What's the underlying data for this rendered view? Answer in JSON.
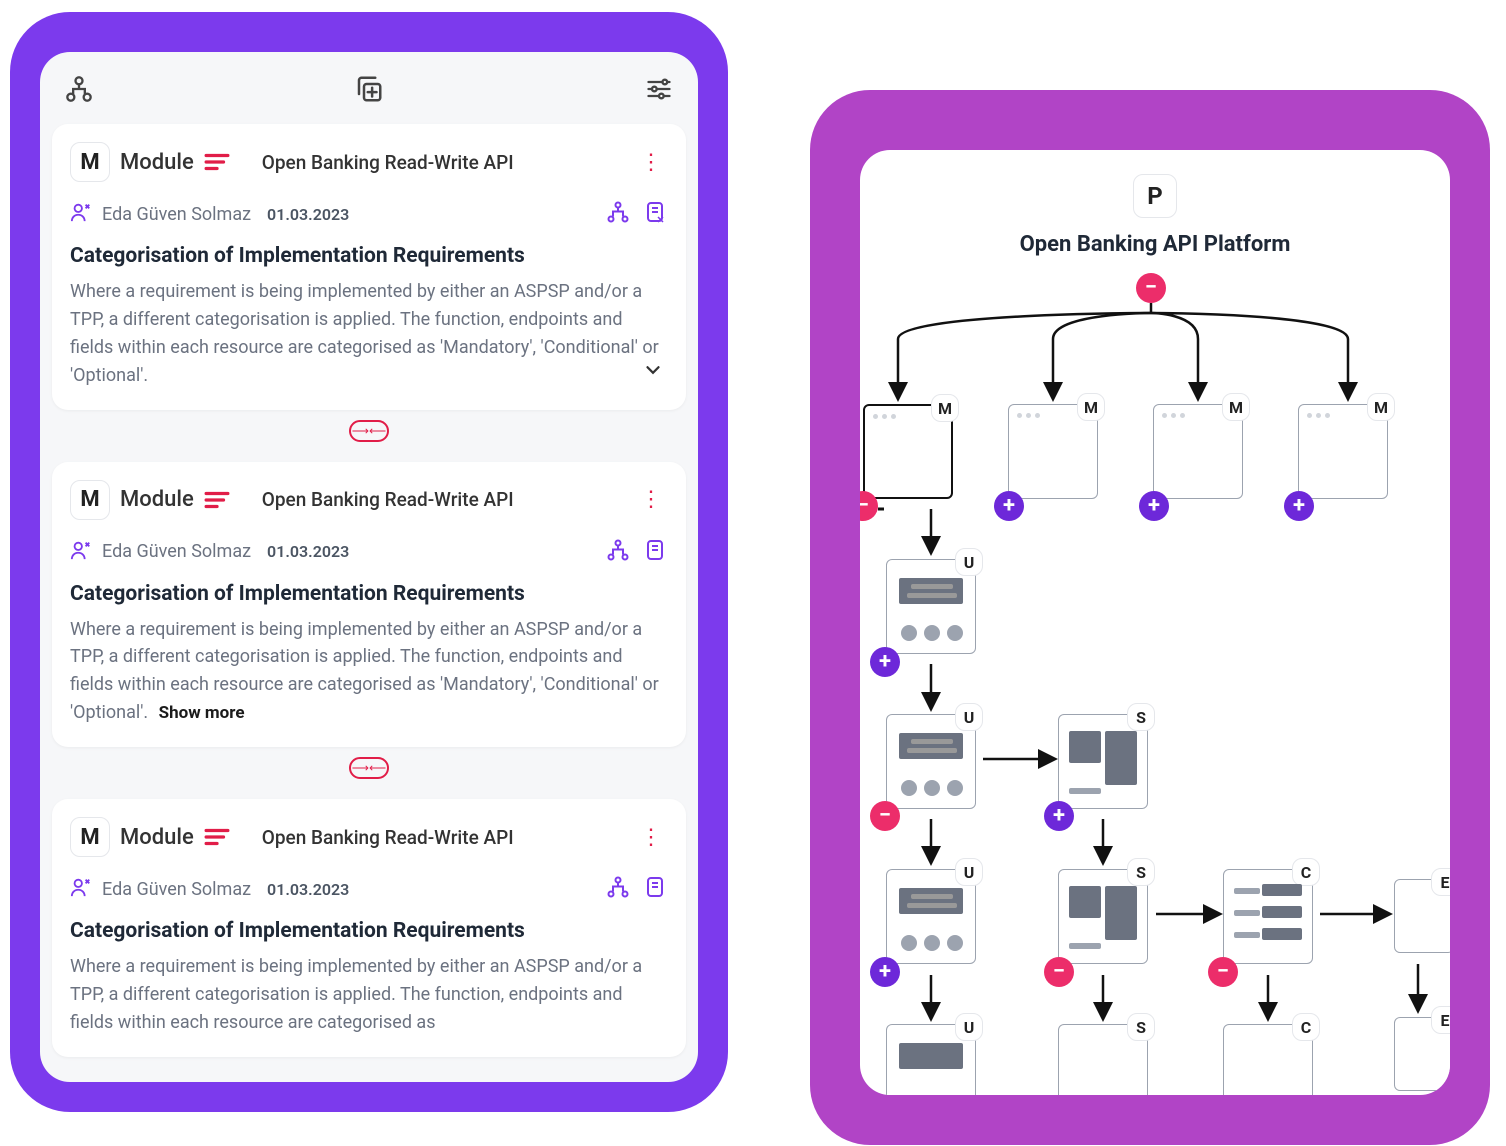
{
  "left": {
    "cards": [
      {
        "typeLetter": "M",
        "typeLabel": "Module",
        "api": "Open Banking Read-Write API",
        "author": "Eda Güven Solmaz",
        "date": "01.03.2023",
        "title": "Categorisation of Implementation Requirements",
        "body": "Where a requirement is being implemented by either an ASPSP and/or a TPP, a different categorisation is applied. The function, endpoints and fields within each resource are categorised as 'Mandatory', 'Conditional' or 'Optional'.",
        "hasChevron": true,
        "showMore": false
      },
      {
        "typeLetter": "M",
        "typeLabel": "Module",
        "api": "Open Banking Read-Write API",
        "author": "Eda Güven Solmaz",
        "date": "01.03.2023",
        "title": "Categorisation of Implementation Requirements",
        "body": "Where a requirement is being implemented by either an ASPSP and/or a TPP, a different categorisation is applied. The function, endpoints and fields within each resource are categorised as 'Mandatory', 'Conditional' or 'Optional'.",
        "hasChevron": false,
        "showMore": true,
        "showMoreLabel": "Show more"
      },
      {
        "typeLetter": "M",
        "typeLabel": "Module",
        "api": "Open Banking Read-Write API",
        "author": "Eda Güven Solmaz",
        "date": "01.03.2023",
        "title": "Categorisation of Implementation Requirements",
        "body": "Where a requirement is being implemented by either an ASPSP and/or a TPP, a different categorisation is applied. The function, endpoints and fields within each resource are categorised as",
        "hasChevron": false,
        "showMore": false
      }
    ]
  },
  "right": {
    "rootLetter": "P",
    "title": "Open Banking API Platform"
  }
}
